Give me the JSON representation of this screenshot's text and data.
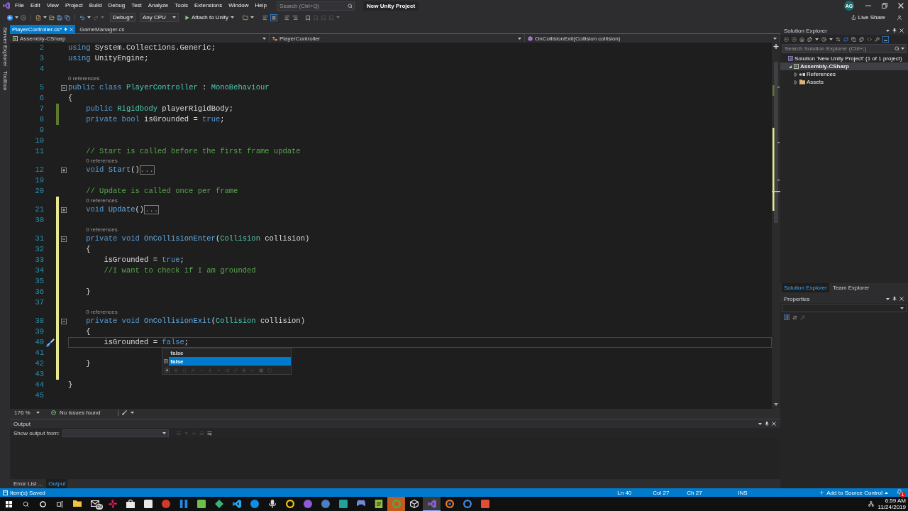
{
  "title_bar": {
    "menu": [
      "File",
      "Edit",
      "View",
      "Project",
      "Build",
      "Debug",
      "Test",
      "Analyze",
      "Tools",
      "Extensions",
      "Window",
      "Help"
    ],
    "search": {
      "placeholder": "Search (Ctrl+Q)"
    },
    "title": "New Unity Project",
    "account": "AG"
  },
  "toolbar": {
    "configuration": "Debug",
    "platform": "Any CPU",
    "start": "Attach to Unity",
    "live_share": "Live Share"
  },
  "side_tabs": [
    "Server Explorer",
    "Toolbox"
  ],
  "document_tabs": [
    {
      "label": "PlayerController.cs*",
      "selected": true
    },
    {
      "label": "GameManager.cs",
      "selected": false
    }
  ],
  "navigation_bar": [
    {
      "kind": "project",
      "label": "Assembly-CSharp"
    },
    {
      "kind": "class",
      "label": "PlayerController"
    },
    {
      "kind": "method",
      "label": "OnCollisionExit(Collision collision)"
    }
  ],
  "editor": {
    "lines": [
      {
        "number": "2",
        "current": false,
        "tokens": [
          {
            "kind": "keyword",
            "text": "using"
          },
          {
            "kind": "plain",
            "text": " System.Collections.Generic;"
          }
        ]
      },
      {
        "number": "3",
        "current": false,
        "tokens": [
          {
            "kind": "keyword",
            "text": "using"
          },
          {
            "kind": "plain",
            "text": " UnityEngine;"
          }
        ]
      },
      {
        "number": "4",
        "current": false
      },
      {
        "number": "5",
        "current": false,
        "lens": "0 references",
        "folded": false,
        "tokens": [
          {
            "kind": "keyword",
            "text": "public class "
          },
          {
            "kind": "type",
            "text": "PlayerController"
          },
          {
            "kind": "plain",
            "text": " : "
          },
          {
            "kind": "type",
            "text": "MonoBehaviour"
          }
        ]
      },
      {
        "number": "6",
        "current": false,
        "tokens": [
          {
            "kind": "plain",
            "text": "{"
          }
        ]
      },
      {
        "number": "7",
        "current": false,
        "color": "#5b7a2c",
        "tokens": [
          {
            "kind": "keyword",
            "text": "    public "
          },
          {
            "kind": "type",
            "text": "Rigidbody"
          },
          {
            "kind": "plain",
            "text": " playerRigidBody;"
          }
        ]
      },
      {
        "number": "8",
        "current": false,
        "color": "#5b7a2c",
        "tokens": [
          {
            "kind": "keyword",
            "text": "    private bool "
          },
          {
            "kind": "plain",
            "text": "isGrounded = "
          },
          {
            "kind": "keyword",
            "text": "true"
          },
          {
            "kind": "plain",
            "text": ";"
          }
        ]
      },
      {
        "number": "9",
        "current": false
      },
      {
        "number": "10",
        "current": false
      },
      {
        "number": "11",
        "current": false,
        "tokens": [
          {
            "kind": "comment",
            "text": "    // Start is called before the first frame update"
          }
        ]
      },
      {
        "number": "12",
        "current": false,
        "lens": "0 references",
        "folded": true,
        "tokens": [
          {
            "kind": "keyword",
            "text": "    void "
          },
          {
            "kind": "method",
            "text": "Start"
          },
          {
            "kind": "plain",
            "text": "()"
          },
          {
            "kind": "collapsed",
            "text": "..."
          }
        ]
      },
      {
        "number": "19",
        "current": false
      },
      {
        "number": "20",
        "current": false,
        "tokens": [
          {
            "kind": "comment",
            "text": "    // Update is called once per frame"
          }
        ]
      },
      {
        "number": "21",
        "current": false,
        "color": "#e8e890",
        "lens": "0 references",
        "folded": true,
        "tokens": [
          {
            "kind": "keyword",
            "text": "    void "
          },
          {
            "kind": "method",
            "text": "Update"
          },
          {
            "kind": "plain",
            "text": "()"
          },
          {
            "kind": "collapsed",
            "text": "..."
          }
        ]
      },
      {
        "number": "30",
        "current": false,
        "color": "#e8e890"
      },
      {
        "number": "31",
        "current": false,
        "color": "#e8e890",
        "lens": "0 references",
        "folded": false,
        "tokens": [
          {
            "kind": "keyword",
            "text": "    private void "
          },
          {
            "kind": "method",
            "text": "OnCollisionEnter"
          },
          {
            "kind": "plain",
            "text": "("
          },
          {
            "kind": "type",
            "text": "Collision"
          },
          {
            "kind": "plain",
            "text": " collision)"
          }
        ]
      },
      {
        "number": "32",
        "current": false,
        "color": "#e8e890",
        "tokens": [
          {
            "kind": "plain",
            "text": "    {"
          }
        ]
      },
      {
        "number": "33",
        "current": false,
        "color": "#e8e890",
        "tokens": [
          {
            "kind": "plain",
            "text": "        isGrounded = "
          },
          {
            "kind": "keyword",
            "text": "true"
          },
          {
            "kind": "plain",
            "text": ";"
          }
        ]
      },
      {
        "number": "34",
        "current": false,
        "color": "#e8e890",
        "tokens": [
          {
            "kind": "comment",
            "text": "        //I want to check if I am grounded"
          }
        ]
      },
      {
        "number": "35",
        "current": false,
        "color": "#e8e890"
      },
      {
        "number": "36",
        "current": false,
        "color": "#e8e890",
        "tokens": [
          {
            "kind": "plain",
            "text": "    }"
          }
        ]
      },
      {
        "number": "37",
        "current": false,
        "color": "#e8e890"
      },
      {
        "number": "38",
        "current": false,
        "color": "#e8e890",
        "lens": "0 references",
        "folded": false,
        "tokens": [
          {
            "kind": "keyword",
            "text": "    private void "
          },
          {
            "kind": "method",
            "text": "OnCollisionExit"
          },
          {
            "kind": "plain",
            "text": "("
          },
          {
            "kind": "type",
            "text": "Collision"
          },
          {
            "kind": "plain",
            "text": " collision)"
          }
        ]
      },
      {
        "number": "39",
        "current": false,
        "color": "#e8e890",
        "tokens": [
          {
            "kind": "plain",
            "text": "    {"
          }
        ]
      },
      {
        "number": "40",
        "current": true,
        "color": "#e8e890",
        "tokens": [
          {
            "kind": "plain",
            "text": "        isGrounded = "
          },
          {
            "kind": "keyword",
            "text": "false"
          },
          {
            "kind": "plain",
            "text": ";"
          }
        ]
      },
      {
        "number": "41",
        "current": false,
        "color": "#e8e890"
      },
      {
        "number": "42",
        "current": false,
        "color": "#e8e890",
        "tokens": [
          {
            "kind": "plain",
            "text": "    }"
          }
        ]
      },
      {
        "number": "43",
        "current": false,
        "color": "#e8e890"
      },
      {
        "number": "44",
        "current": false,
        "tokens": [
          {
            "kind": "plain",
            "text": "}"
          }
        ]
      },
      {
        "number": "45",
        "current": false
      }
    ],
    "completion": [
      {
        "kind": "suggestion",
        "label": "false",
        "selected": false
      },
      {
        "kind": "keyword",
        "label": "false",
        "selected": true
      }
    ],
    "zoom": "176 %",
    "issues": "No issues found"
  },
  "solution_explorer": {
    "title": "Solution Explorer",
    "search": {
      "placeholder": "Search Solution Explorer (Ctrl+;)"
    },
    "tree": [
      {
        "kind": "solution",
        "label": "Solution 'New Unity Project' (1 of 1 project)",
        "selected": false,
        "children": [
          {
            "kind": "project",
            "label": "Assembly-CSharp",
            "expanded": true,
            "selected": true,
            "children": [
              {
                "kind": "references",
                "label": "References",
                "expanded": false,
                "selected": false
              },
              {
                "kind": "folder",
                "label": "Assets",
                "expanded": false,
                "selected": false
              }
            ]
          }
        ]
      }
    ],
    "tabs": [
      {
        "label": "Solution Explorer",
        "selected": true
      },
      {
        "label": "Team Explorer",
        "selected": false
      }
    ]
  },
  "properties": {
    "title": "Properties"
  },
  "output": {
    "title": "Output",
    "source_label": "Show output from:",
    "tabs": [
      {
        "label": "Error List ...",
        "selected": false
      },
      {
        "label": "Output",
        "selected": true
      }
    ]
  },
  "status_bar": {
    "message": "Item(s) Saved",
    "line": "Ln 40",
    "column": "Col 27",
    "character": "Ch 27",
    "mode": "INS",
    "source_control": "Add to Source Control",
    "notifications": "1"
  },
  "taskbar": {
    "apps": [
      {
        "kind": "folder",
        "color": "#f0c43c",
        "active": false,
        "highlighted": false
      },
      {
        "kind": "mail",
        "color": "#e8e8e8",
        "badge": "69",
        "active": false,
        "highlighted": false
      },
      {
        "kind": "pinwheel",
        "color": "#e01e5a",
        "active": false,
        "highlighted": false
      },
      {
        "kind": "bag",
        "color": "#e8e8e8",
        "active": false,
        "highlighted": false
      },
      {
        "kind": "tile",
        "color": "#e8e8e8",
        "active": false,
        "highlighted": false
      },
      {
        "kind": "disc",
        "color": "#d23a2e",
        "active": false,
        "highlighted": false
      },
      {
        "kind": "bars",
        "color": "#1e88e5",
        "active": false,
        "highlighted": false
      },
      {
        "kind": "tile",
        "color": "#6cc04a",
        "active": false,
        "highlighted": false
      },
      {
        "kind": "diamond",
        "color": "#3bb273",
        "active": false,
        "highlighted": false
      },
      {
        "kind": "ribbon",
        "color": "#23a9f2",
        "active": false,
        "highlighted": false
      },
      {
        "kind": "disc",
        "color": "#0e8ee9",
        "active": false,
        "highlighted": false
      },
      {
        "kind": "mic",
        "color": "#d8d8d8",
        "active": false,
        "highlighted": false
      },
      {
        "kind": "ring",
        "color": "#f2c811",
        "active": false,
        "highlighted": false
      },
      {
        "kind": "disc",
        "color": "#8e5bd8",
        "active": false,
        "highlighted": false
      },
      {
        "kind": "disc",
        "color": "#4a7fc1",
        "active": false,
        "highlighted": false
      },
      {
        "kind": "tile",
        "color": "#1fa39a",
        "active": false,
        "highlighted": false
      },
      {
        "kind": "gamepad",
        "color": "#7289da",
        "active": false,
        "highlighted": false
      },
      {
        "kind": "notepad",
        "color": "#90c040",
        "active": false,
        "highlighted": false
      },
      {
        "kind": "ring",
        "color": "#4caf50",
        "active": false,
        "highlighted": true
      },
      {
        "kind": "cube",
        "color": "#e8e8e8",
        "active": false,
        "highlighted": false
      },
      {
        "kind": "ribbon",
        "color": "#8661c5",
        "active": true,
        "highlighted": false
      },
      {
        "kind": "orbit",
        "color": "#f5792a",
        "active": false,
        "highlighted": false
      },
      {
        "kind": "ring",
        "color": "#3c8ee6",
        "active": false,
        "highlighted": false
      },
      {
        "kind": "tile",
        "color": "#e04e39",
        "active": false,
        "highlighted": false
      }
    ],
    "time": "6:59 AM",
    "date": "11/24/2019"
  }
}
